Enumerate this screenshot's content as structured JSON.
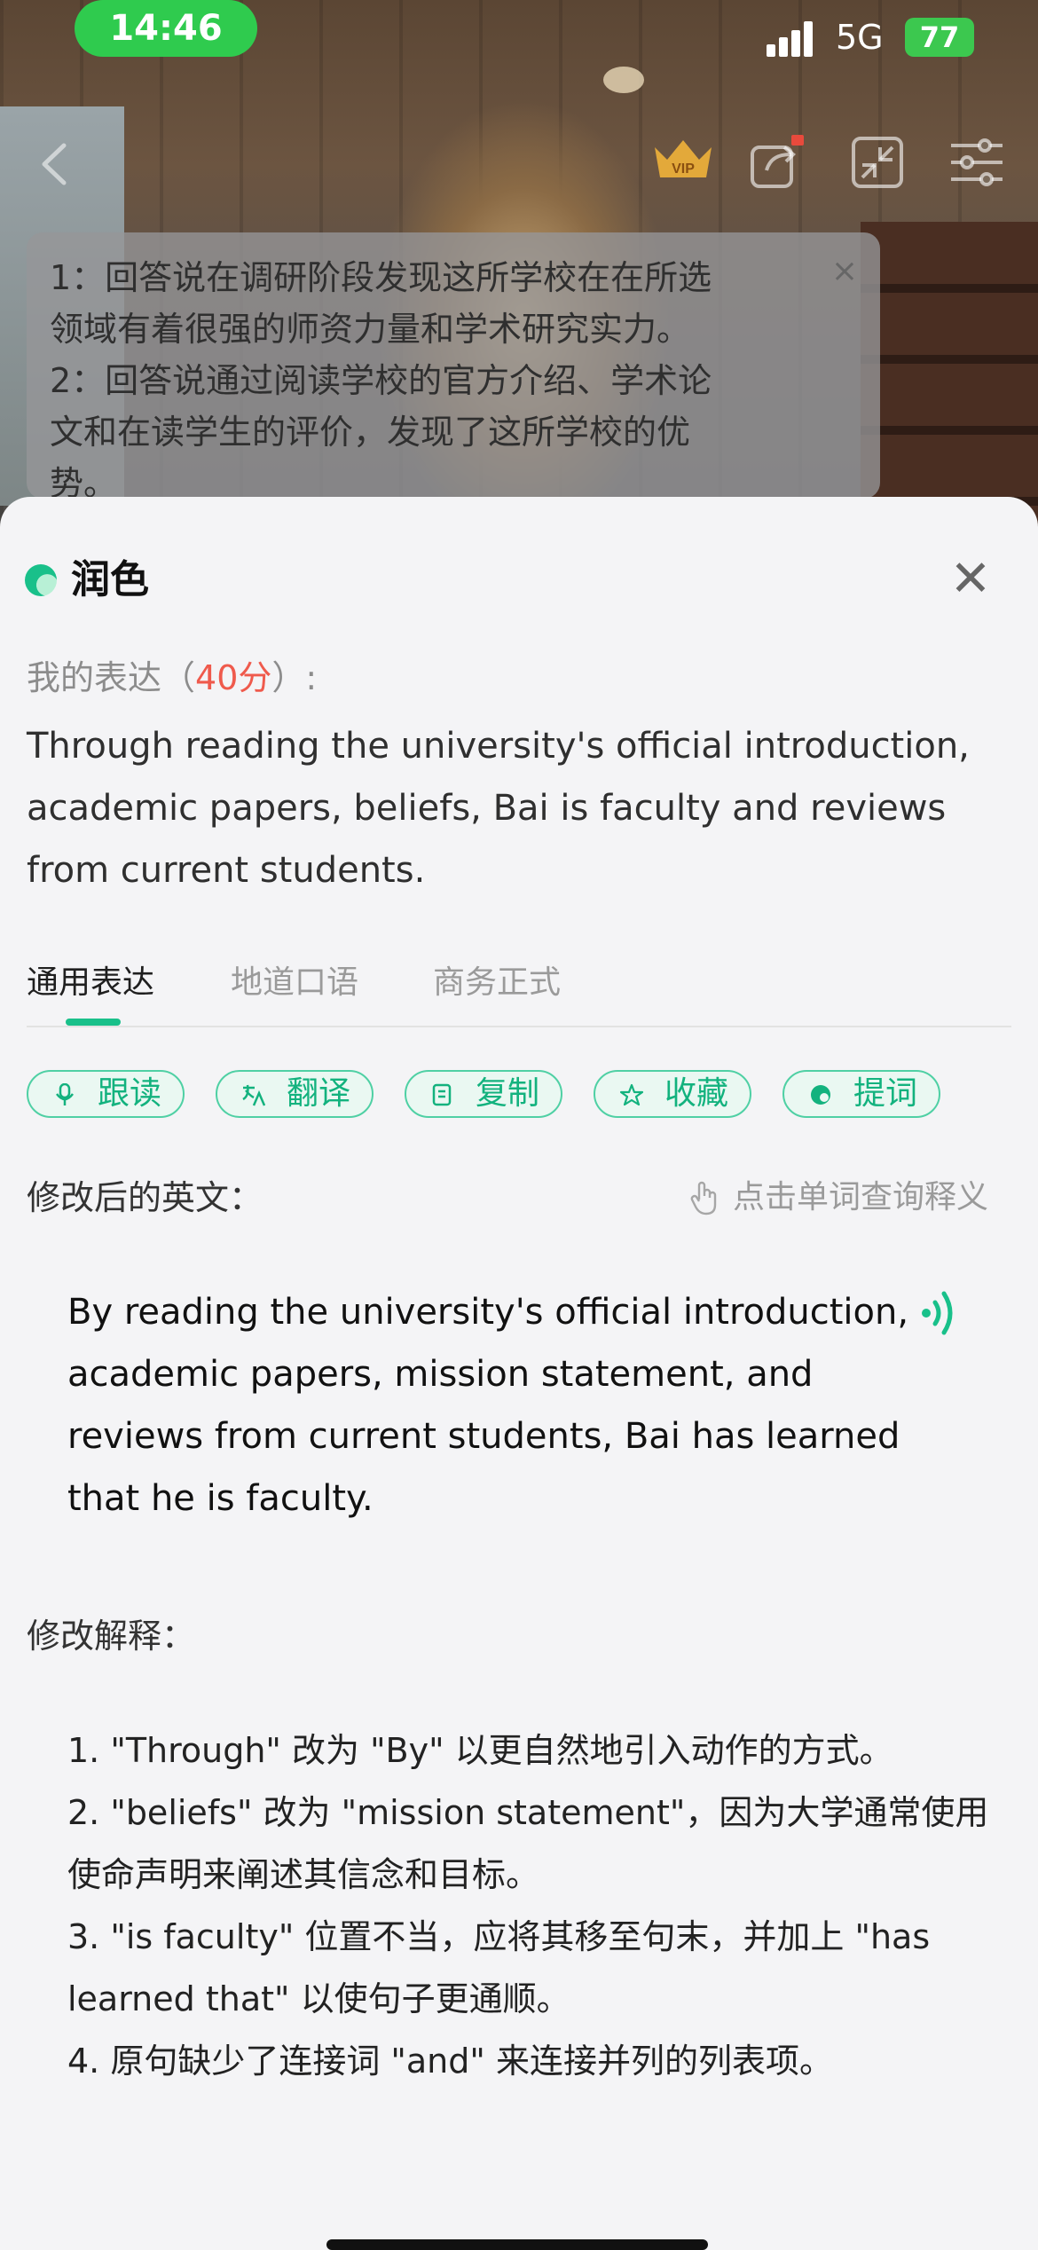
{
  "status_bar": {
    "time": "14:46",
    "network": "5G",
    "battery": "77"
  },
  "top_bar": {
    "vip_badge": "VIP"
  },
  "hint_panel": {
    "lines": [
      "1：回答说在调研阶段发现这所学校在在所选",
      "领域有着很强的师资力量和学术研究实力。",
      "2：回答说通过阅读学校的官方介绍、学术论",
      "文和在读学生的评价，发现了这所学校的优",
      "势。"
    ],
    "close_glyph": "×"
  },
  "sheet": {
    "title": "润色",
    "close_glyph": "✕",
    "my_expression_label": "我的表达（",
    "score": "40分",
    "my_expression_suffix": "）:",
    "original_text": "Through reading the university's official introduction, academic papers, beliefs, Bai is faculty and reviews from current students.",
    "tabs": [
      {
        "label": "通用表达",
        "active": true
      },
      {
        "label": "地道口语",
        "active": false
      },
      {
        "label": "商务正式",
        "active": false
      }
    ],
    "actions": [
      {
        "label": "跟读",
        "icon": "microphone-icon"
      },
      {
        "label": "翻译",
        "icon": "translate-icon"
      },
      {
        "label": "复制",
        "icon": "copy-icon"
      },
      {
        "label": "收藏",
        "icon": "star-icon"
      },
      {
        "label": "提词",
        "icon": "prompt-icon"
      }
    ],
    "revised_label": "修改后的英文：",
    "lookup_hint": "点击单词查询释义",
    "revised_text": "By reading the university's official introduction, academic papers, mission statement, and reviews from current students, Bai has learned that he is faculty.",
    "explanation_label": "修改解释：",
    "explanations": [
      "1. \"Through\" 改为 \"By\" 以更自然地引入动作的方式。",
      "2. \"beliefs\" 改为 \"mission statement\"，因为大学通常使用使命声明来阐述其信念和目标。",
      "3. \"is faculty\" 位置不当，应将其移至句末，并加上 \"has learned that\" 以使句子更通顺。",
      "4. 原句缺少了连接词 \"and\" 来连接并列的列表项。"
    ]
  },
  "colors": {
    "accent": "#19c08a",
    "score": "#ef5a4c",
    "status_green": "#2fcb4e"
  }
}
